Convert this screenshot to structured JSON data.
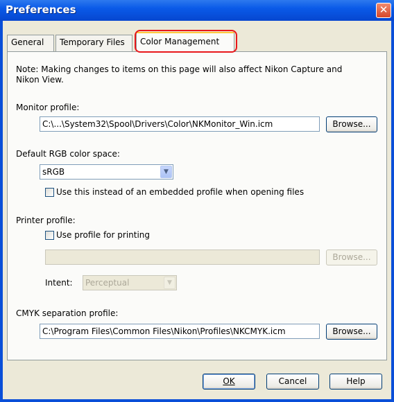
{
  "window": {
    "title": "Preferences",
    "close_glyph": "✕"
  },
  "tabs": [
    {
      "label": "General"
    },
    {
      "label": "Temporary Files"
    },
    {
      "label": "Color Management"
    }
  ],
  "note": {
    "line1": "Note: Making changes to items on this page will also affect Nikon Capture and",
    "line2": "Nikon View."
  },
  "monitor": {
    "label": "Monitor profile:",
    "path": "C:\\...\\System32\\Spool\\Drivers\\Color\\NKMonitor_Win.icm",
    "browse": "Browse..."
  },
  "rgb": {
    "label": "Default RGB color space:",
    "value": "sRGB",
    "checkbox_label": "Use this instead of an embedded profile when opening files",
    "checked": false
  },
  "printer": {
    "label": "Printer profile:",
    "checkbox_label": "Use profile for printing",
    "checked": false,
    "path": "",
    "browse": "Browse...",
    "intent_label": "Intent:",
    "intent_value": "Perceptual"
  },
  "cmyk": {
    "label": "CMYK separation profile:",
    "path": "C:\\Program Files\\Common Files\\Nikon\\Profiles\\NKCMYK.icm",
    "browse": "Browse..."
  },
  "buttons": {
    "ok": "OK",
    "cancel": "Cancel",
    "help": "Help"
  },
  "colors": {
    "titlebar": "#0a5ae8",
    "face": "#ece9d8",
    "highlight_ring": "#e8161a"
  }
}
